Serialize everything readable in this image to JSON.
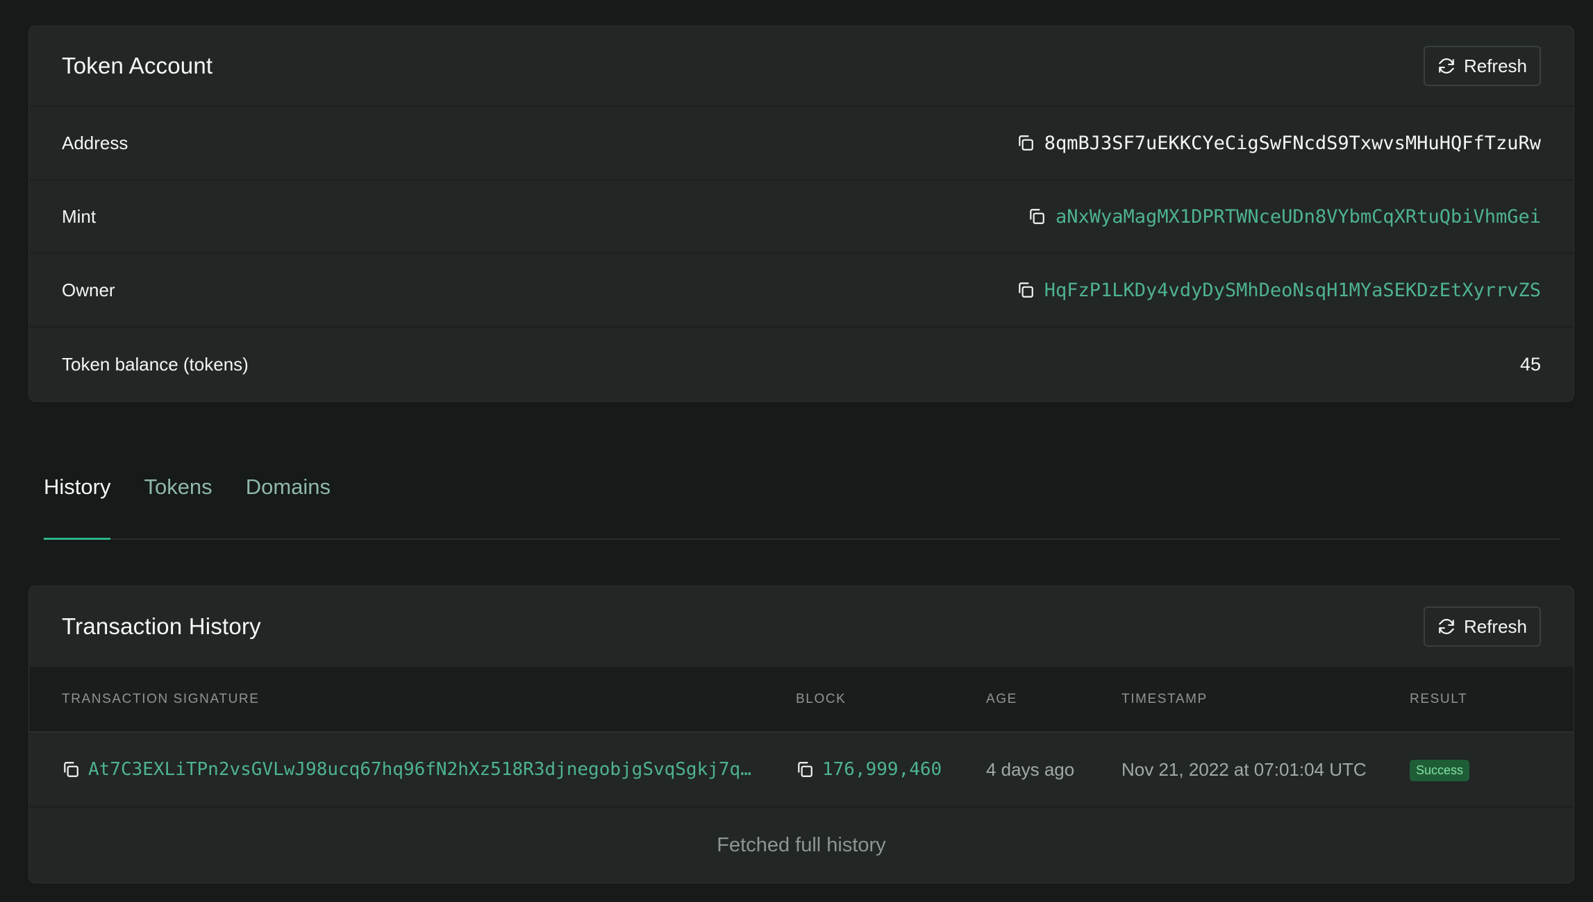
{
  "token_account": {
    "title": "Token Account",
    "refresh_label": "Refresh",
    "rows": [
      {
        "label": "Address",
        "value": "8qmBJ3SF7uEKKCYeCigSwFNcdS9TxwvsMHuHQFfTzuRw"
      },
      {
        "label": "Mint",
        "value": "aNxWyaMagMX1DPRTWNceUDn8VYbmCqXRtuQbiVhmGei"
      },
      {
        "label": "Owner",
        "value": "HqFzP1LKDy4vdyDySMhDeoNsqH1MYaSEKDzEtXyrrvZS"
      },
      {
        "label": "Token balance (tokens)",
        "value": "45"
      }
    ]
  },
  "tabs": [
    {
      "label": "History",
      "active": true
    },
    {
      "label": "Tokens",
      "active": false
    },
    {
      "label": "Domains",
      "active": false
    }
  ],
  "history": {
    "title": "Transaction History",
    "refresh_label": "Refresh",
    "columns": [
      "TRANSACTION SIGNATURE",
      "BLOCK",
      "AGE",
      "TIMESTAMP",
      "RESULT"
    ],
    "rows": [
      {
        "signature": "At7C3EXLiTPn2vsGVLwJ98ucq67hq96fN2hXz518R3djnegobjgSvqSgkj7q…",
        "block": "176,999,460",
        "age": "4 days ago",
        "timestamp": "Nov 21, 2022 at 07:01:04 UTC",
        "result": "Success"
      }
    ],
    "footer": "Fetched full history"
  },
  "colors": {
    "background": "#161a19",
    "card": "#222625",
    "link": "#4eb38f",
    "tab_indicator": "#2fb38c",
    "success_badge": "#1f5d37"
  },
  "icons": {
    "refresh": "refresh-icon",
    "copy": "copy-icon"
  }
}
